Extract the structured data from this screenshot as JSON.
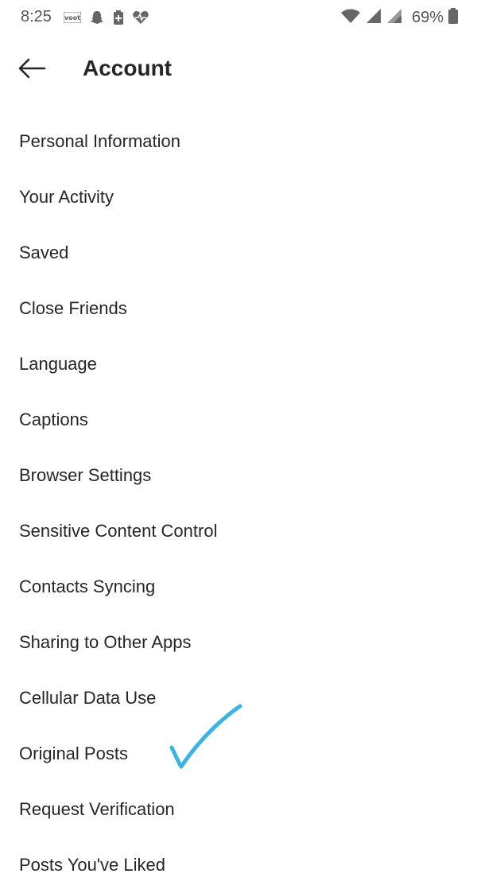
{
  "status_bar": {
    "time": "8:25",
    "left_icons": [
      "voot-icon",
      "snapchat-icon",
      "battery-saver-icon",
      "health-icon"
    ],
    "right_icons": [
      "wifi-icon",
      "signal-icon",
      "signal-icon-2"
    ],
    "battery_percent": "69%"
  },
  "header": {
    "title": "Account"
  },
  "menu": {
    "items": [
      {
        "label": "Personal Information"
      },
      {
        "label": "Your Activity"
      },
      {
        "label": "Saved"
      },
      {
        "label": "Close Friends"
      },
      {
        "label": "Language"
      },
      {
        "label": "Captions"
      },
      {
        "label": "Browser Settings"
      },
      {
        "label": "Sensitive Content Control"
      },
      {
        "label": "Contacts Syncing"
      },
      {
        "label": "Sharing to Other Apps"
      },
      {
        "label": "Cellular Data Use"
      },
      {
        "label": "Original Posts"
      },
      {
        "label": "Request Verification"
      },
      {
        "label": "Posts You've Liked"
      }
    ]
  },
  "annotation": {
    "checkmark_color": "#3bb4e5"
  }
}
